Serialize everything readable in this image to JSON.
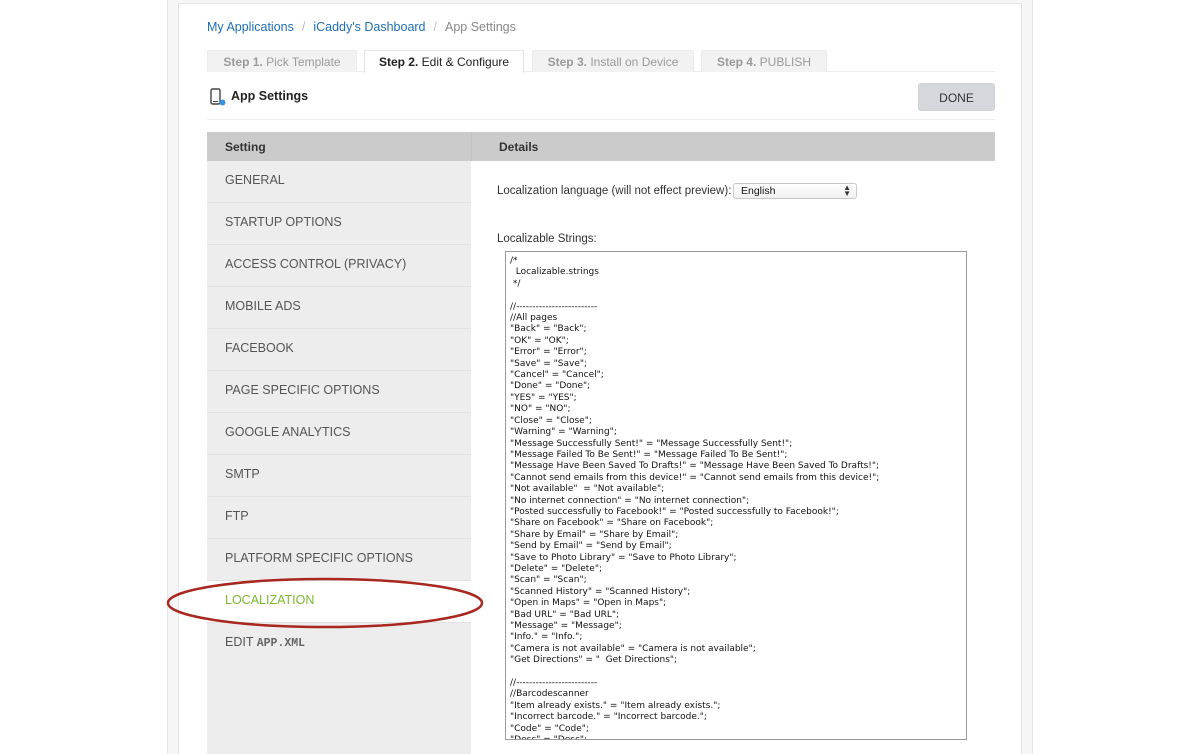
{
  "breadcrumb": {
    "items": [
      {
        "label": "My Applications"
      },
      {
        "label": "iCaddy's Dashboard"
      }
    ],
    "separator": "/",
    "current": "App Settings"
  },
  "tabs": [
    {
      "step": "Step 1.",
      "label": "Pick Template"
    },
    {
      "step": "Step 2.",
      "label": "Edit & Configure",
      "active": true
    },
    {
      "step": "Step 3.",
      "label": "Install on Device"
    },
    {
      "step": "Step 4.",
      "label": "PUBLISH"
    }
  ],
  "settings_header": {
    "title": "App Settings",
    "icon": "phone-settings-icon",
    "done_label": "DONE"
  },
  "table": {
    "col_setting": "Setting",
    "col_details": "Details"
  },
  "sidebar": {
    "items": [
      {
        "label": "GENERAL"
      },
      {
        "label": "STARTUP OPTIONS"
      },
      {
        "label": "ACCESS CONTROL (PRIVACY)"
      },
      {
        "label": "MOBILE ADS"
      },
      {
        "label": "FACEBOOK"
      },
      {
        "label": "PAGE SPECIFIC OPTIONS"
      },
      {
        "label": "GOOGLE ANALYTICS"
      },
      {
        "label": "SMTP"
      },
      {
        "label": "FTP"
      },
      {
        "label": "PLATFORM SPECIFIC OPTIONS"
      },
      {
        "label": "LOCALIZATION",
        "active": true
      },
      {
        "label": "EDIT ",
        "code": "APP.XML"
      }
    ],
    "active_color": "#7cb82f"
  },
  "details": {
    "language_label": "Localization language (will not effect preview):",
    "language_value": "English",
    "strings_label": "Localizable Strings:",
    "strings_content": "/*\n  Localizable.strings\n */\n\n//-------------------------\n//All pages\n\"Back\" = \"Back\";\n\"OK\" = \"OK\";\n\"Error\" = \"Error\";\n\"Save\" = \"Save\";\n\"Cancel\" = \"Cancel\";\n\"Done\" = \"Done\";\n\"YES\" = \"YES\";\n\"NO\" = \"NO\";\n\"Close\" = \"Close\";\n\"Warning\" = \"Warning\";\n\"Message Successfully Sent!\" = \"Message Successfully Sent!\";\n\"Message Failed To Be Sent!\" = \"Message Failed To Be Sent!\";\n\"Message Have Been Saved To Drafts!\" = \"Message Have Been Saved To Drafts!\";\n\"Cannot send emails from this device!\" = \"Cannot send emails from this device!\";\n\"Not available\"  = \"Not available\";\n\"No internet connection\" = \"No internet connection\";\n\"Posted successfully to Facebook!\" = \"Posted successfully to Facebook!\";\n\"Share on Facebook\" = \"Share on Facebook\";\n\"Share by Email\" = \"Share by Email\";\n\"Send by Email\" = \"Send by Email\";\n\"Save to Photo Library\" = \"Save to Photo Library\";\n\"Delete\" = \"Delete\";\n\"Scan\" = \"Scan\";\n\"Scanned History\" = \"Scanned History\";\n\"Open in Maps\" = \"Open in Maps\";\n\"Bad URL\" = \"Bad URL\";\n\"Message\" = \"Message\";\n\"Info.\" = \"Info.\";\n\"Camera is not available\" = \"Camera is not available\";\n\"Get Directions\" = \"  Get Directions\";\n\n//-------------------------\n//Barcodescanner\n\"Item already exists.\" = \"Item already exists.\";\n\"Incorrect barcode.\" = \"Incorrect barcode.\";\n\"Code\" = \"Code\";\n\"Desc\" = \"Desc\";"
  },
  "annotation": {
    "type": "highlight-ellipse",
    "target": "LOCALIZATION",
    "color": "#a8271f"
  }
}
